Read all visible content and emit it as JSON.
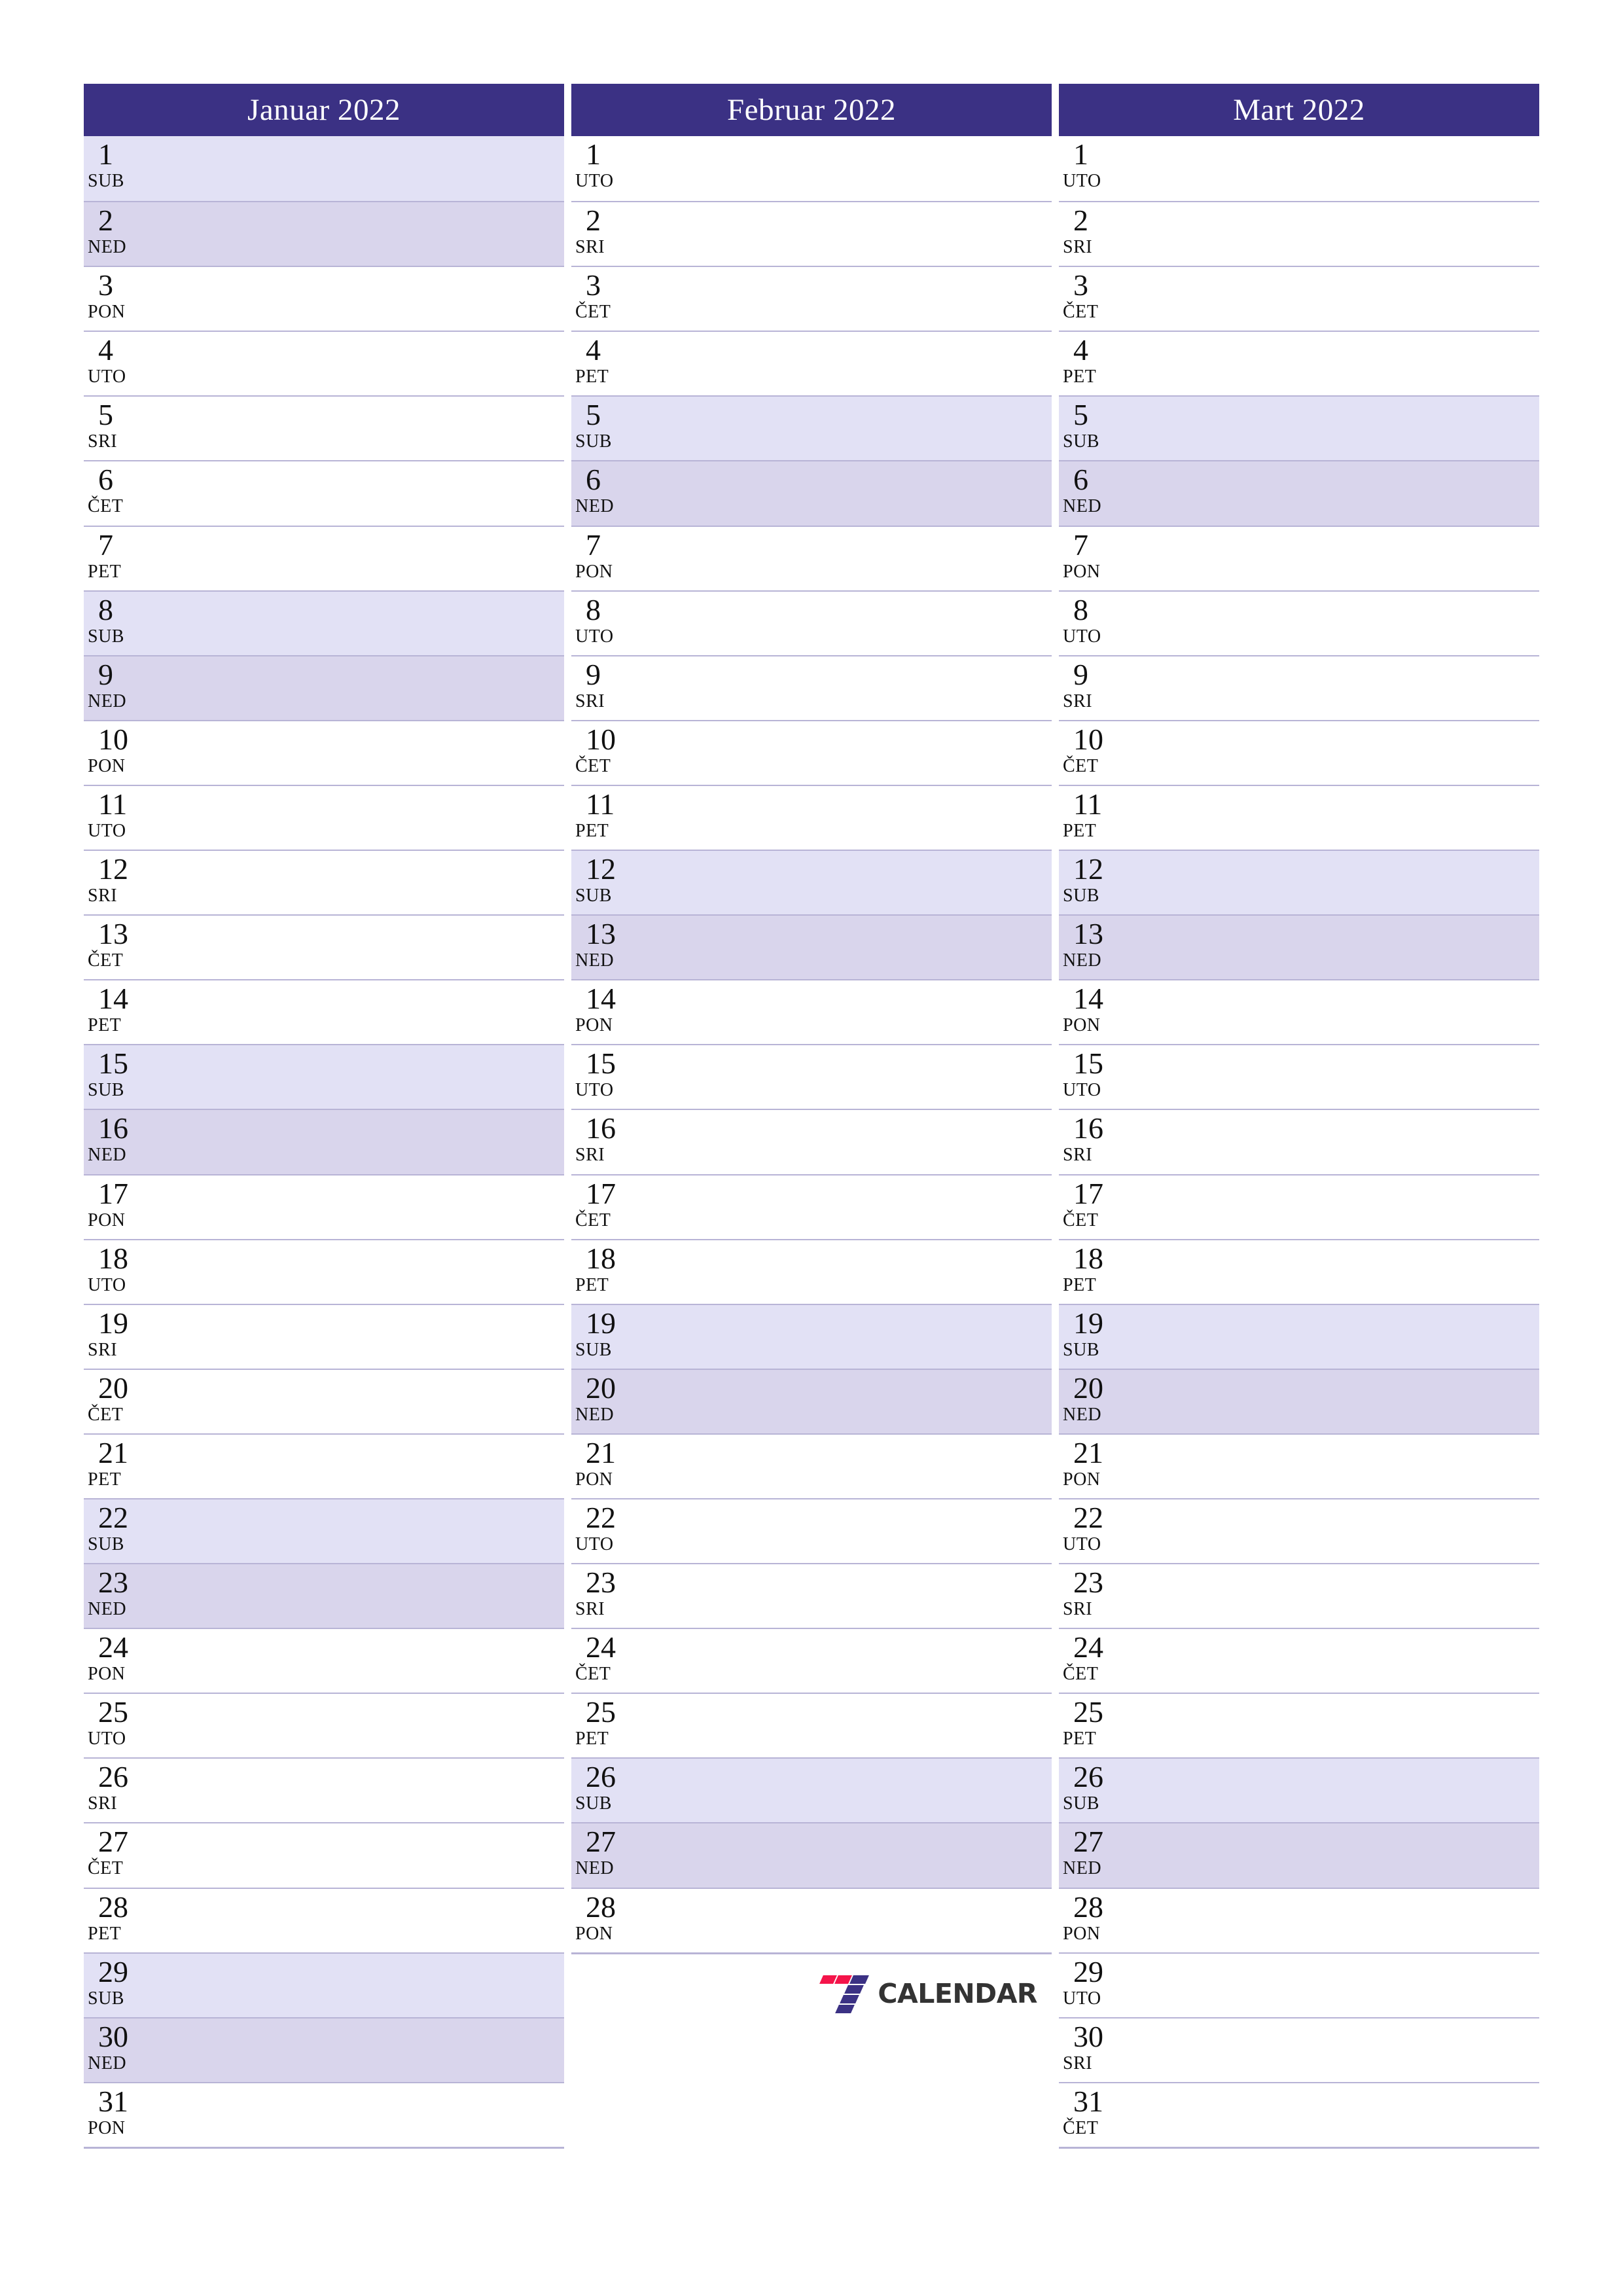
{
  "page": {
    "title": "Calendar 2022 Q1 (Serbian) - Vertical 3-month planner",
    "colors": {
      "header_bg": "#3b3184",
      "header_text": "#ffffff",
      "saturday_bg": "#e2e1f5",
      "sunday_bg": "#d9d5ec",
      "rule": "#b8b4d6",
      "logo_red": "#f4144a",
      "logo_blue": "#3b3184",
      "logo_word": "#333333",
      "page_bg": "#ffffff"
    }
  },
  "logo": {
    "name": "7-calendar-logo",
    "word": "CALENDAR",
    "digit": "7"
  },
  "months": [
    {
      "id": "januar",
      "title": "Januar 2022",
      "days": [
        {
          "num": "1",
          "dow": "SUB",
          "type": "sat"
        },
        {
          "num": "2",
          "dow": "NED",
          "type": "sun"
        },
        {
          "num": "3",
          "dow": "PON",
          "type": "wd"
        },
        {
          "num": "4",
          "dow": "UTO",
          "type": "wd"
        },
        {
          "num": "5",
          "dow": "SRI",
          "type": "wd"
        },
        {
          "num": "6",
          "dow": "ČET",
          "type": "wd"
        },
        {
          "num": "7",
          "dow": "PET",
          "type": "wd"
        },
        {
          "num": "8",
          "dow": "SUB",
          "type": "sat"
        },
        {
          "num": "9",
          "dow": "NED",
          "type": "sun"
        },
        {
          "num": "10",
          "dow": "PON",
          "type": "wd"
        },
        {
          "num": "11",
          "dow": "UTO",
          "type": "wd"
        },
        {
          "num": "12",
          "dow": "SRI",
          "type": "wd"
        },
        {
          "num": "13",
          "dow": "ČET",
          "type": "wd"
        },
        {
          "num": "14",
          "dow": "PET",
          "type": "wd"
        },
        {
          "num": "15",
          "dow": "SUB",
          "type": "sat"
        },
        {
          "num": "16",
          "dow": "NED",
          "type": "sun"
        },
        {
          "num": "17",
          "dow": "PON",
          "type": "wd"
        },
        {
          "num": "18",
          "dow": "UTO",
          "type": "wd"
        },
        {
          "num": "19",
          "dow": "SRI",
          "type": "wd"
        },
        {
          "num": "20",
          "dow": "ČET",
          "type": "wd"
        },
        {
          "num": "21",
          "dow": "PET",
          "type": "wd"
        },
        {
          "num": "22",
          "dow": "SUB",
          "type": "sat"
        },
        {
          "num": "23",
          "dow": "NED",
          "type": "sun"
        },
        {
          "num": "24",
          "dow": "PON",
          "type": "wd"
        },
        {
          "num": "25",
          "dow": "UTO",
          "type": "wd"
        },
        {
          "num": "26",
          "dow": "SRI",
          "type": "wd"
        },
        {
          "num": "27",
          "dow": "ČET",
          "type": "wd"
        },
        {
          "num": "28",
          "dow": "PET",
          "type": "wd"
        },
        {
          "num": "29",
          "dow": "SUB",
          "type": "sat"
        },
        {
          "num": "30",
          "dow": "NED",
          "type": "sun"
        },
        {
          "num": "31",
          "dow": "PON",
          "type": "wd"
        }
      ],
      "has_logo": false
    },
    {
      "id": "februar",
      "title": "Februar 2022",
      "days": [
        {
          "num": "1",
          "dow": "UTO",
          "type": "wd"
        },
        {
          "num": "2",
          "dow": "SRI",
          "type": "wd"
        },
        {
          "num": "3",
          "dow": "ČET",
          "type": "wd"
        },
        {
          "num": "4",
          "dow": "PET",
          "type": "wd"
        },
        {
          "num": "5",
          "dow": "SUB",
          "type": "sat"
        },
        {
          "num": "6",
          "dow": "NED",
          "type": "sun"
        },
        {
          "num": "7",
          "dow": "PON",
          "type": "wd"
        },
        {
          "num": "8",
          "dow": "UTO",
          "type": "wd"
        },
        {
          "num": "9",
          "dow": "SRI",
          "type": "wd"
        },
        {
          "num": "10",
          "dow": "ČET",
          "type": "wd"
        },
        {
          "num": "11",
          "dow": "PET",
          "type": "wd"
        },
        {
          "num": "12",
          "dow": "SUB",
          "type": "sat"
        },
        {
          "num": "13",
          "dow": "NED",
          "type": "sun"
        },
        {
          "num": "14",
          "dow": "PON",
          "type": "wd"
        },
        {
          "num": "15",
          "dow": "UTO",
          "type": "wd"
        },
        {
          "num": "16",
          "dow": "SRI",
          "type": "wd"
        },
        {
          "num": "17",
          "dow": "ČET",
          "type": "wd"
        },
        {
          "num": "18",
          "dow": "PET",
          "type": "wd"
        },
        {
          "num": "19",
          "dow": "SUB",
          "type": "sat"
        },
        {
          "num": "20",
          "dow": "NED",
          "type": "sun"
        },
        {
          "num": "21",
          "dow": "PON",
          "type": "wd"
        },
        {
          "num": "22",
          "dow": "UTO",
          "type": "wd"
        },
        {
          "num": "23",
          "dow": "SRI",
          "type": "wd"
        },
        {
          "num": "24",
          "dow": "ČET",
          "type": "wd"
        },
        {
          "num": "25",
          "dow": "PET",
          "type": "wd"
        },
        {
          "num": "26",
          "dow": "SUB",
          "type": "sat"
        },
        {
          "num": "27",
          "dow": "NED",
          "type": "sun"
        },
        {
          "num": "28",
          "dow": "PON",
          "type": "wd"
        }
      ],
      "has_logo": true
    },
    {
      "id": "mart",
      "title": "Mart 2022",
      "days": [
        {
          "num": "1",
          "dow": "UTO",
          "type": "wd"
        },
        {
          "num": "2",
          "dow": "SRI",
          "type": "wd"
        },
        {
          "num": "3",
          "dow": "ČET",
          "type": "wd"
        },
        {
          "num": "4",
          "dow": "PET",
          "type": "wd"
        },
        {
          "num": "5",
          "dow": "SUB",
          "type": "sat"
        },
        {
          "num": "6",
          "dow": "NED",
          "type": "sun"
        },
        {
          "num": "7",
          "dow": "PON",
          "type": "wd"
        },
        {
          "num": "8",
          "dow": "UTO",
          "type": "wd"
        },
        {
          "num": "9",
          "dow": "SRI",
          "type": "wd"
        },
        {
          "num": "10",
          "dow": "ČET",
          "type": "wd"
        },
        {
          "num": "11",
          "dow": "PET",
          "type": "wd"
        },
        {
          "num": "12",
          "dow": "SUB",
          "type": "sat"
        },
        {
          "num": "13",
          "dow": "NED",
          "type": "sun"
        },
        {
          "num": "14",
          "dow": "PON",
          "type": "wd"
        },
        {
          "num": "15",
          "dow": "UTO",
          "type": "wd"
        },
        {
          "num": "16",
          "dow": "SRI",
          "type": "wd"
        },
        {
          "num": "17",
          "dow": "ČET",
          "type": "wd"
        },
        {
          "num": "18",
          "dow": "PET",
          "type": "wd"
        },
        {
          "num": "19",
          "dow": "SUB",
          "type": "sat"
        },
        {
          "num": "20",
          "dow": "NED",
          "type": "sun"
        },
        {
          "num": "21",
          "dow": "PON",
          "type": "wd"
        },
        {
          "num": "22",
          "dow": "UTO",
          "type": "wd"
        },
        {
          "num": "23",
          "dow": "SRI",
          "type": "wd"
        },
        {
          "num": "24",
          "dow": "ČET",
          "type": "wd"
        },
        {
          "num": "25",
          "dow": "PET",
          "type": "wd"
        },
        {
          "num": "26",
          "dow": "SUB",
          "type": "sat"
        },
        {
          "num": "27",
          "dow": "NED",
          "type": "sun"
        },
        {
          "num": "28",
          "dow": "PON",
          "type": "wd"
        },
        {
          "num": "29",
          "dow": "UTO",
          "type": "wd"
        },
        {
          "num": "30",
          "dow": "SRI",
          "type": "wd"
        },
        {
          "num": "31",
          "dow": "ČET",
          "type": "wd"
        }
      ],
      "has_logo": false
    }
  ]
}
